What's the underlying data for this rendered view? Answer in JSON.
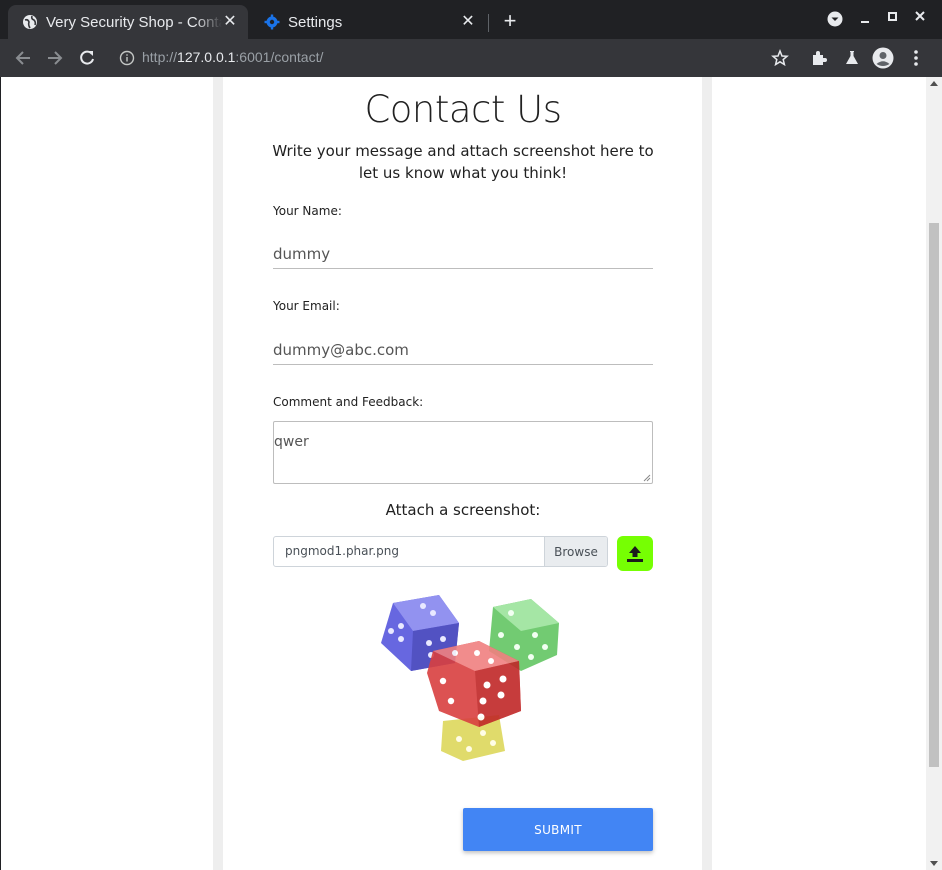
{
  "browser": {
    "tabs": [
      {
        "title": "Very Security Shop - Contact",
        "active": true
      },
      {
        "title": "Settings",
        "active": false
      }
    ],
    "url": {
      "scheme": "http://",
      "host": "127.0.0.1",
      "rest": ":6001/contact/"
    }
  },
  "page": {
    "heading": "Contact Us",
    "subtext": "Write your message and attach screenshot here to let us know what you think!",
    "name_label": "Your Name:",
    "name_value": "dummy",
    "email_label": "Your Email:",
    "email_value": "dummy@abc.com",
    "comment_label": "Comment and Feedback:",
    "comment_value": "qwer",
    "attach_label": "Attach a screenshot:",
    "file_name": "pngmod1.phar.png",
    "browse_label": "Browse",
    "submit_label": "SUBMIT"
  },
  "colors": {
    "upload_button": "#76ff03",
    "submit_button": "#4285f4"
  }
}
